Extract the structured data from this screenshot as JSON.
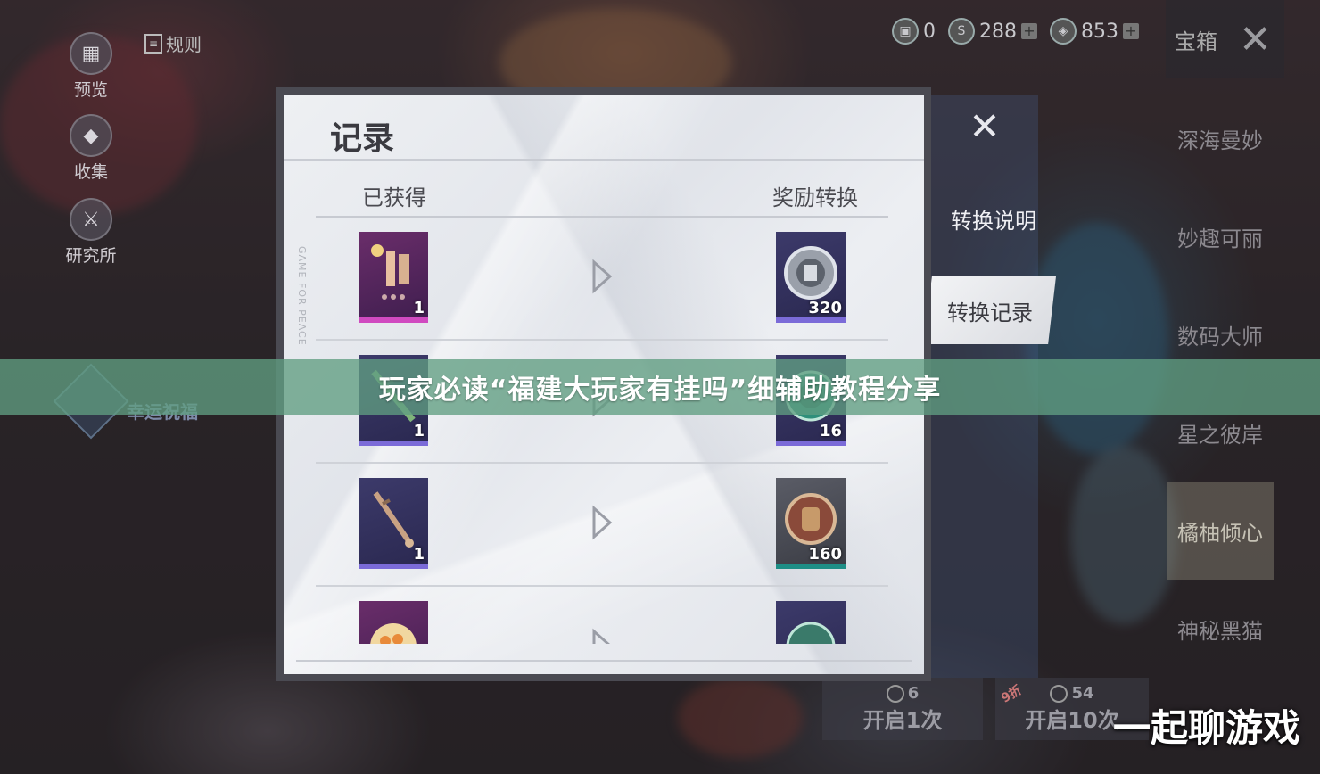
{
  "left_menu": [
    {
      "label": "预览",
      "icon": "grid-icon"
    },
    {
      "label": "收集",
      "icon": "diamond-icon"
    },
    {
      "label": "研究所",
      "icon": "sword-icon"
    }
  ],
  "rules_label": "规则",
  "currencies": [
    {
      "icon": "card-icon",
      "value": "0"
    },
    {
      "icon": "coin-icon",
      "value": "288"
    },
    {
      "icon": "ticket-icon",
      "value": "853"
    }
  ],
  "treasure_label": "宝箱",
  "skins": [
    "深海曼妙",
    "妙趣可丽",
    "数码大师",
    "星之彼岸",
    "橘柚倾心",
    "神秘黑猫"
  ],
  "selected_skin": "橘柚倾心",
  "lucky_label": "幸运祝福",
  "open_buttons": [
    {
      "label": "开启1次",
      "cost": "6"
    },
    {
      "label": "开启10次",
      "cost": "54",
      "badge": "9折"
    }
  ],
  "dialog": {
    "title": "记录",
    "side_text": "GAME FOR PEACE",
    "col_obtained": "已获得",
    "col_reward": "奖励转换",
    "rows": [
      {
        "obtained_count": "1",
        "obtained_icon": "outfit-set-icon",
        "reward_count": "320",
        "reward_icon": "silver-coin-icon"
      },
      {
        "obtained_count": "1",
        "obtained_icon": "rifle-skin-icon",
        "reward_count": "16",
        "reward_icon": "green-medal-icon"
      },
      {
        "obtained_count": "1",
        "obtained_icon": "rifle-icon",
        "reward_count": "160",
        "reward_icon": "armor-token-icon"
      },
      {
        "obtained_count": "",
        "obtained_icon": "food-plate-icon",
        "reward_count": "",
        "reward_icon": "green-token-icon"
      }
    ]
  },
  "tabs": {
    "info": "转换说明",
    "record": "转换记录"
  },
  "banner": "玩家必读“福建大玩家有挂吗”细辅助教程分享",
  "watermark": "一起聊游戏"
}
